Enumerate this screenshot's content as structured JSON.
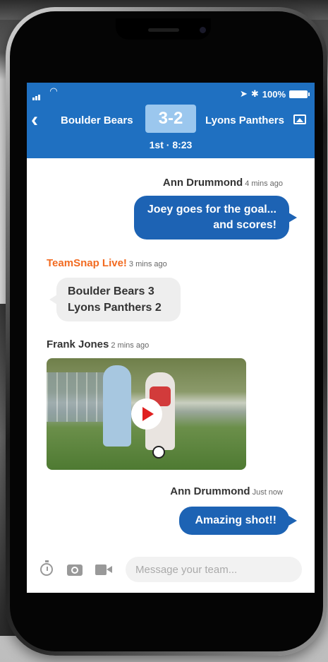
{
  "status_bar": {
    "wifi_icon": "wifi-icon",
    "location_icon": "location-arrow-icon",
    "bluetooth_icon": "bluetooth-icon",
    "battery_text": "100%"
  },
  "header": {
    "home_team": "Boulder Bears",
    "score": "3-2",
    "away_team": "Lyons Panthers",
    "period": "1st · 8:23"
  },
  "messages": [
    {
      "sender": "Ann Drummond",
      "time": "4 mins ago",
      "lines": [
        "Joey goes for the goal...",
        "and scores!"
      ],
      "direction": "outgoing"
    },
    {
      "sender": "TeamSnap Live!",
      "time": "3 mins ago",
      "lines": [
        "Boulder Bears 3",
        "Lyons Panthers 2"
      ],
      "direction": "incoming"
    },
    {
      "sender": "Frank Jones",
      "time": "2 mins ago",
      "media": "video",
      "direction": "incoming"
    },
    {
      "sender": "Ann Drummond",
      "time": "Just now",
      "lines": [
        "Amazing shot!!"
      ],
      "direction": "outgoing"
    }
  ],
  "composer": {
    "placeholder": "Message your team..."
  },
  "colors": {
    "header_bg": "#1f70c1",
    "outgoing_bubble": "#1d63b4",
    "incoming_bubble": "#eeeeee",
    "live_sender": "#f26b21"
  }
}
